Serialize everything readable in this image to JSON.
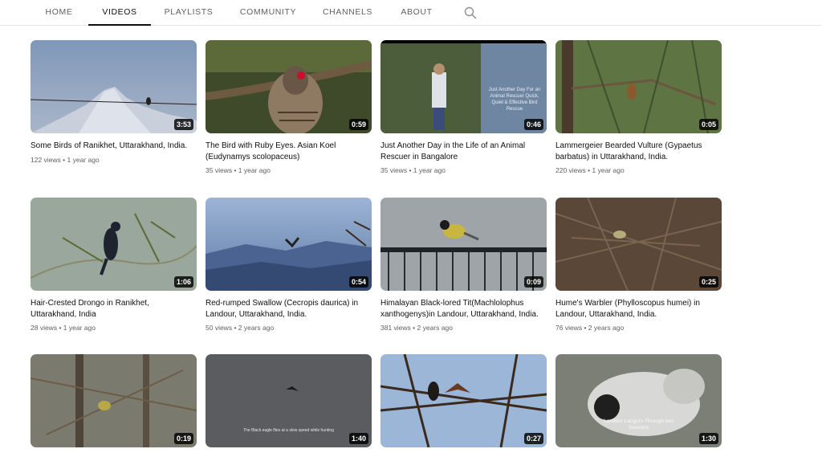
{
  "tabs": {
    "home": "HOME",
    "videos": "VIDEOS",
    "playlists": "PLAYLISTS",
    "community": "COMMUNITY",
    "channels": "CHANNELS",
    "about": "ABOUT"
  },
  "videos": [
    {
      "title": "Some Birds of Ranikhet, Uttarakhand, India.",
      "views": "122 views",
      "age": "1 year ago",
      "duration": "3:53"
    },
    {
      "title": "The Bird with Ruby Eyes. Asian Koel (Eudynamys scolopaceus)",
      "views": "35 views",
      "age": "1 year ago",
      "duration": "0:59"
    },
    {
      "title": "Just Another Day in the Life of an Animal Rescuer in Bangalore",
      "views": "35 views",
      "age": "1 year ago",
      "duration": "0:46",
      "thumb_text": "Just Another Day For an Animal Rescuer Quick, Quiet & Effective Bird Rescue"
    },
    {
      "title": "Lammergeier Bearded Vulture (Gypaetus barbatus) in Uttarakhand, India.",
      "views": "220 views",
      "age": "1 year ago",
      "duration": "0:05"
    },
    {
      "title": "Hair-Crested Drongo in Ranikhet, Uttarakhand, India",
      "views": "28 views",
      "age": "1 year ago",
      "duration": "1:06"
    },
    {
      "title": "Red-rumped Swallow (Cecropis daurica) in Landour, Uttarakhand, India.",
      "views": "50 views",
      "age": "2 years ago",
      "duration": "0:54"
    },
    {
      "title": "Himalayan Black-lored Tit(Machlolophus xanthogenys)in Landour, Uttarakhand, India.",
      "views": "381 views",
      "age": "2 years ago",
      "duration": "0:09"
    },
    {
      "title": "Hume's Warbler (Phylloscopus humei) in Landour, Uttarakhand, India.",
      "views": "76 views",
      "age": "2 years ago",
      "duration": "0:25"
    },
    {
      "title": "",
      "views": "",
      "age": "",
      "duration": "0:19"
    },
    {
      "title": "",
      "views": "",
      "age": "",
      "duration": "1:40",
      "thumb_text": "The Black eagle flies at a slow speed while hunting"
    },
    {
      "title": "",
      "views": "",
      "age": "",
      "duration": "0:27"
    },
    {
      "title": "",
      "views": "",
      "age": "",
      "duration": "1:30",
      "thumb_text": "Landour Langurs Through two Seasons"
    }
  ],
  "separator": " • ",
  "icons": {
    "search": "search-icon"
  }
}
